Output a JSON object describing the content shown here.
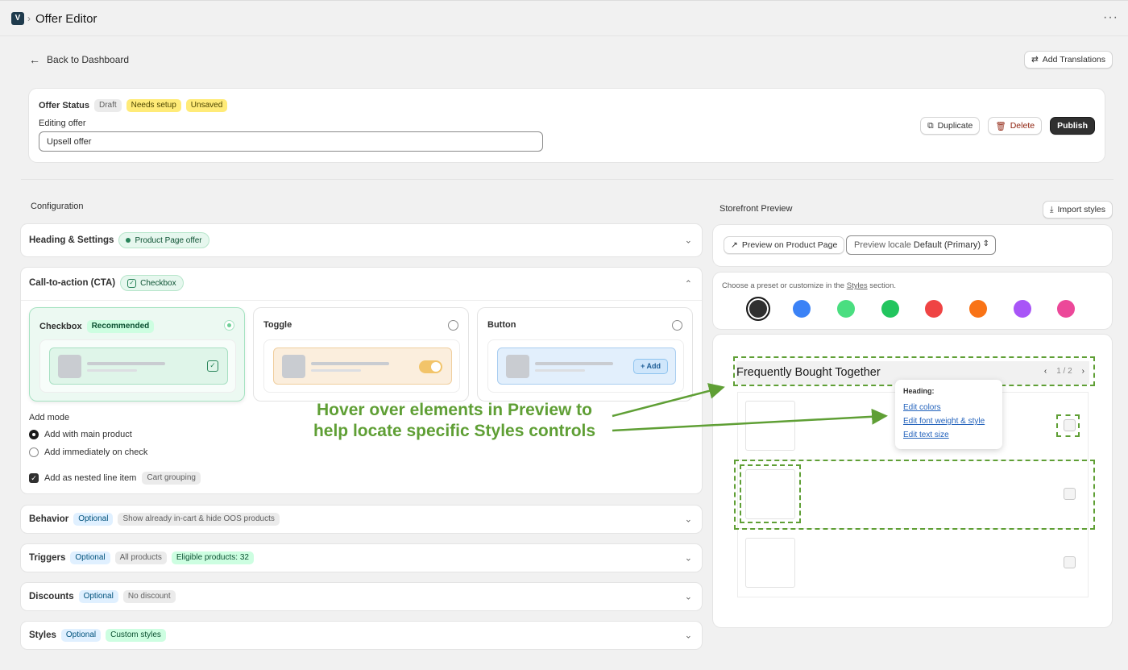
{
  "topbar": {
    "title": "Offer Editor",
    "logo_glyph": "V"
  },
  "back": {
    "label": "Back to Dashboard"
  },
  "translations_button": "Add Translations",
  "status": {
    "label": "Offer Status",
    "badges": [
      "Draft",
      "Needs setup",
      "Unsaved"
    ],
    "editing_label": "Editing offer",
    "offer_name": "Upsell offer",
    "duplicate": "Duplicate",
    "delete": "Delete",
    "publish": "Publish"
  },
  "config": {
    "title": "Configuration",
    "heading": {
      "title": "Heading & Settings",
      "pill": "Product Page offer"
    },
    "cta": {
      "title": "Call-to-action (CTA)",
      "pill": "Checkbox",
      "options": [
        {
          "title": "Checkbox",
          "badge": "Recommended"
        },
        {
          "title": "Toggle"
        },
        {
          "title": "Button",
          "add_label": "+ Add"
        }
      ],
      "add_mode_label": "Add mode",
      "add_mode_options": [
        "Add with main product",
        "Add immediately on check"
      ],
      "nested_label": "Add as nested line item",
      "nested_badge": "Cart grouping"
    },
    "behavior": {
      "title": "Behavior",
      "badges": [
        "Optional",
        "Show already in-cart & hide OOS products"
      ]
    },
    "triggers": {
      "title": "Triggers",
      "badges": [
        "Optional",
        "All products",
        "Eligible products: 32"
      ]
    },
    "discounts": {
      "title": "Discounts",
      "badges": [
        "Optional",
        "No discount"
      ]
    },
    "styles": {
      "title": "Styles",
      "badges": [
        "Optional",
        "Custom styles"
      ]
    }
  },
  "preview": {
    "title": "Storefront Preview",
    "import_button": "Import styles",
    "product_page_button": "Preview on Product Page",
    "locale_label": "Preview locale",
    "locale_value": "Default (Primary)",
    "preset_hint_before": "Choose a preset or customize in the",
    "preset_hint_link": "Styles",
    "preset_hint_after": "section.",
    "swatches": [
      "#303030",
      "#3b82f6",
      "#4ade80",
      "#22c55e",
      "#ef4444",
      "#f97316",
      "#a855f7",
      "#ec4899"
    ],
    "widget_title": "Frequently Bought Together",
    "pager": "1 / 2",
    "tooltip": {
      "heading": "Heading:",
      "links": [
        "Edit colors",
        "Edit font weight & style",
        "Edit text size"
      ]
    }
  },
  "annotation": {
    "line1": "Hover over elements in Preview to",
    "line2": "help locate specific Styles controls",
    "color": "#5f9f35"
  }
}
